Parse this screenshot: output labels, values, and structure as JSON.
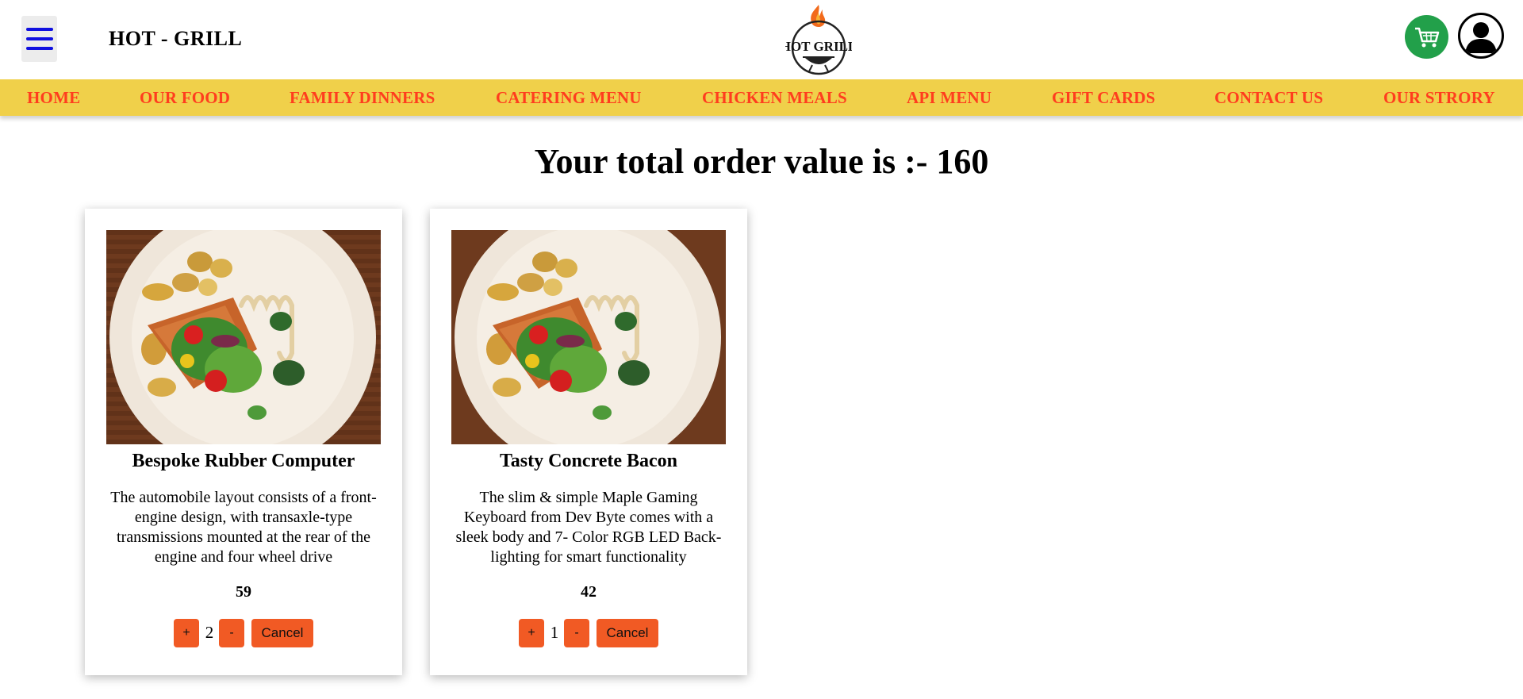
{
  "header": {
    "brand": "HOT - GRILL",
    "logo_text": "HOT GRILL",
    "menu_icon": "hamburger-icon",
    "cart_icon": "cart-icon",
    "profile_icon": "user-avatar-icon"
  },
  "nav": {
    "items": [
      {
        "label": "HOME"
      },
      {
        "label": "OUR FOOD"
      },
      {
        "label": "FAMILY DINNERS"
      },
      {
        "label": "CATERING MENU"
      },
      {
        "label": "CHICKEN MEALS"
      },
      {
        "label": "API MENU"
      },
      {
        "label": "GIFT CARDS"
      },
      {
        "label": "CONTACT US"
      },
      {
        "label": "OUR STRORY"
      }
    ]
  },
  "order": {
    "total_text": "Your total order value is :- 160"
  },
  "cards": [
    {
      "name": "Bespoke Rubber Computer",
      "description": "The automobile layout consists of a front-engine design, with transaxle-type transmissions mounted at the rear of the engine and four wheel drive",
      "price": "59",
      "quantity": "2",
      "plus_label": "+",
      "minus_label": "-",
      "cancel_label": "Cancel"
    },
    {
      "name": "Tasty Concrete Bacon",
      "description": "The slim & simple Maple Gaming Keyboard from Dev Byte comes with a sleek body and 7- Color RGB LED Back-lighting for smart functionality",
      "price": "42",
      "quantity": "1",
      "plus_label": "+",
      "minus_label": "-",
      "cancel_label": "Cancel"
    }
  ],
  "colors": {
    "nav_bg": "#f0d04a",
    "nav_text": "#ff3d1e",
    "button": "#f15a24",
    "cart": "#22a04a",
    "menu_icon": "#1010e0"
  }
}
